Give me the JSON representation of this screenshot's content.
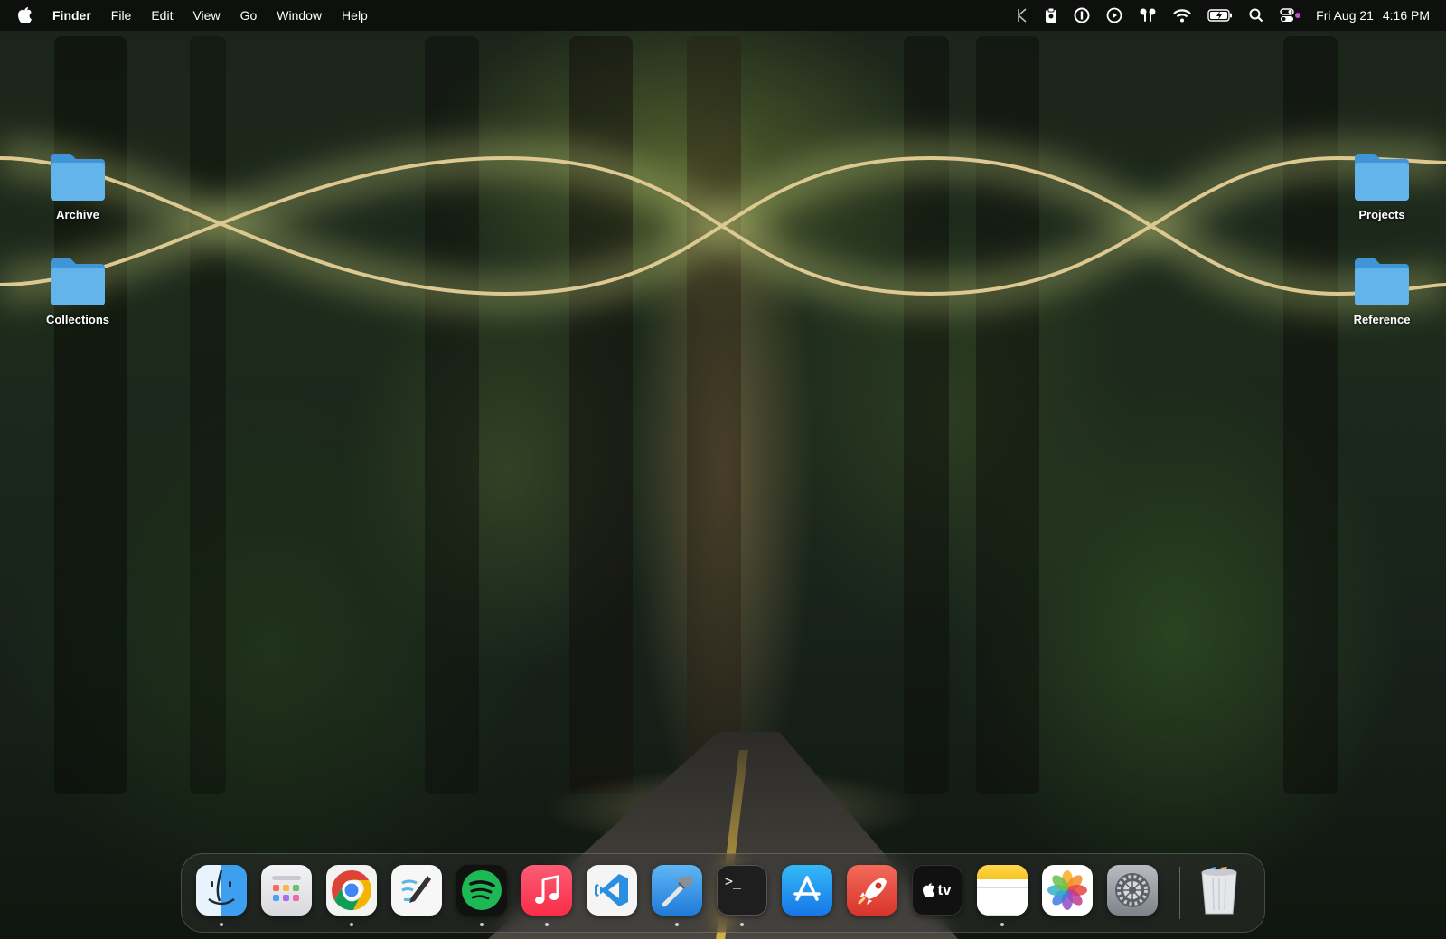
{
  "menubar": {
    "app_name": "Finder",
    "menus": [
      "File",
      "Edit",
      "View",
      "Go",
      "Window",
      "Help"
    ],
    "status_icons": [
      "klack-icon",
      "clipboard-icon",
      "password-manager-icon",
      "play-circle-icon",
      "airpods-icon",
      "wifi-icon",
      "battery-charging-icon",
      "spotlight-search-icon",
      "control-center-icon"
    ],
    "date": "Fri Aug 21",
    "time": "4:16 PM"
  },
  "desktop": {
    "folders": [
      {
        "label": "Archive"
      },
      {
        "label": "Collections"
      },
      {
        "label": "Projects"
      },
      {
        "label": "Reference"
      }
    ]
  },
  "dock": {
    "apps": [
      {
        "name": "finder-icon",
        "running": true
      },
      {
        "name": "launchpad-icon",
        "running": false
      },
      {
        "name": "chrome-icon",
        "running": true
      },
      {
        "name": "freeform-icon",
        "running": false
      },
      {
        "name": "spotify-icon",
        "running": true
      },
      {
        "name": "music-icon",
        "running": true
      },
      {
        "name": "vscode-icon",
        "running": false
      },
      {
        "name": "xcode-icon",
        "running": true
      },
      {
        "name": "terminal-icon",
        "running": true
      },
      {
        "name": "app-store-icon",
        "running": false
      },
      {
        "name": "rocket-typist-icon",
        "running": false
      },
      {
        "name": "apple-tv-icon",
        "running": false
      },
      {
        "name": "notes-icon",
        "running": true
      },
      {
        "name": "photos-icon",
        "running": false
      },
      {
        "name": "system-settings-icon",
        "running": false
      },
      {
        "name": "trash-icon",
        "running": false
      }
    ],
    "tv_label": "tv",
    "terminal_prompt": ">_"
  },
  "colors": {
    "folder_blue": "#5aaee6",
    "wave_gold": "#d9c48a",
    "spotify_green": "#1db954",
    "music_red": "#fa2d48",
    "vscode_blue": "#2b8fe0"
  }
}
